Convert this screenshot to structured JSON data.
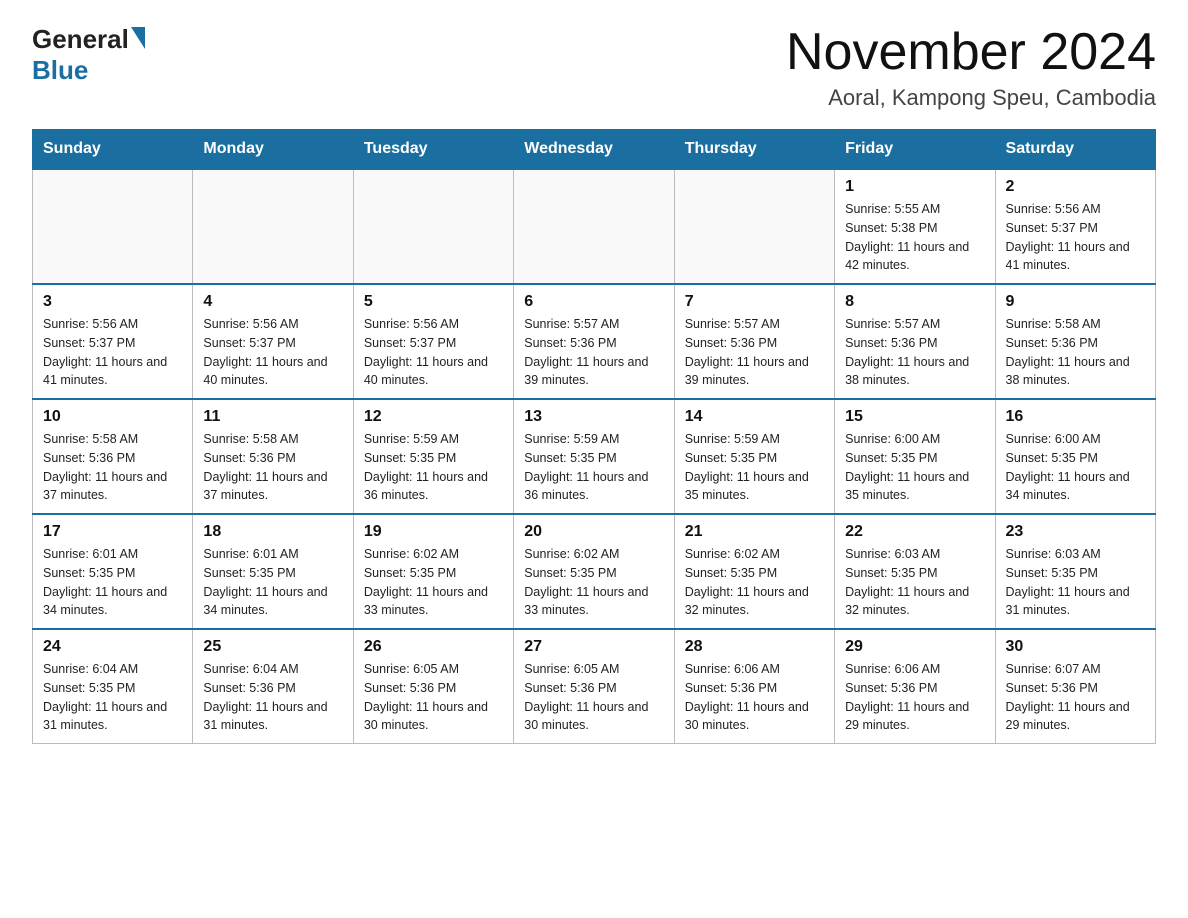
{
  "header": {
    "logo_general": "General",
    "logo_blue": "Blue",
    "month_year": "November 2024",
    "location": "Aoral, Kampong Speu, Cambodia"
  },
  "days_of_week": [
    "Sunday",
    "Monday",
    "Tuesday",
    "Wednesday",
    "Thursday",
    "Friday",
    "Saturday"
  ],
  "weeks": [
    [
      {
        "day": "",
        "sunrise": "",
        "sunset": "",
        "daylight": "",
        "empty": true
      },
      {
        "day": "",
        "sunrise": "",
        "sunset": "",
        "daylight": "",
        "empty": true
      },
      {
        "day": "",
        "sunrise": "",
        "sunset": "",
        "daylight": "",
        "empty": true
      },
      {
        "day": "",
        "sunrise": "",
        "sunset": "",
        "daylight": "",
        "empty": true
      },
      {
        "day": "",
        "sunrise": "",
        "sunset": "",
        "daylight": "",
        "empty": true
      },
      {
        "day": "1",
        "sunrise": "Sunrise: 5:55 AM",
        "sunset": "Sunset: 5:38 PM",
        "daylight": "Daylight: 11 hours and 42 minutes.",
        "empty": false
      },
      {
        "day": "2",
        "sunrise": "Sunrise: 5:56 AM",
        "sunset": "Sunset: 5:37 PM",
        "daylight": "Daylight: 11 hours and 41 minutes.",
        "empty": false
      }
    ],
    [
      {
        "day": "3",
        "sunrise": "Sunrise: 5:56 AM",
        "sunset": "Sunset: 5:37 PM",
        "daylight": "Daylight: 11 hours and 41 minutes.",
        "empty": false
      },
      {
        "day": "4",
        "sunrise": "Sunrise: 5:56 AM",
        "sunset": "Sunset: 5:37 PM",
        "daylight": "Daylight: 11 hours and 40 minutes.",
        "empty": false
      },
      {
        "day": "5",
        "sunrise": "Sunrise: 5:56 AM",
        "sunset": "Sunset: 5:37 PM",
        "daylight": "Daylight: 11 hours and 40 minutes.",
        "empty": false
      },
      {
        "day": "6",
        "sunrise": "Sunrise: 5:57 AM",
        "sunset": "Sunset: 5:36 PM",
        "daylight": "Daylight: 11 hours and 39 minutes.",
        "empty": false
      },
      {
        "day": "7",
        "sunrise": "Sunrise: 5:57 AM",
        "sunset": "Sunset: 5:36 PM",
        "daylight": "Daylight: 11 hours and 39 minutes.",
        "empty": false
      },
      {
        "day": "8",
        "sunrise": "Sunrise: 5:57 AM",
        "sunset": "Sunset: 5:36 PM",
        "daylight": "Daylight: 11 hours and 38 minutes.",
        "empty": false
      },
      {
        "day": "9",
        "sunrise": "Sunrise: 5:58 AM",
        "sunset": "Sunset: 5:36 PM",
        "daylight": "Daylight: 11 hours and 38 minutes.",
        "empty": false
      }
    ],
    [
      {
        "day": "10",
        "sunrise": "Sunrise: 5:58 AM",
        "sunset": "Sunset: 5:36 PM",
        "daylight": "Daylight: 11 hours and 37 minutes.",
        "empty": false
      },
      {
        "day": "11",
        "sunrise": "Sunrise: 5:58 AM",
        "sunset": "Sunset: 5:36 PM",
        "daylight": "Daylight: 11 hours and 37 minutes.",
        "empty": false
      },
      {
        "day": "12",
        "sunrise": "Sunrise: 5:59 AM",
        "sunset": "Sunset: 5:35 PM",
        "daylight": "Daylight: 11 hours and 36 minutes.",
        "empty": false
      },
      {
        "day": "13",
        "sunrise": "Sunrise: 5:59 AM",
        "sunset": "Sunset: 5:35 PM",
        "daylight": "Daylight: 11 hours and 36 minutes.",
        "empty": false
      },
      {
        "day": "14",
        "sunrise": "Sunrise: 5:59 AM",
        "sunset": "Sunset: 5:35 PM",
        "daylight": "Daylight: 11 hours and 35 minutes.",
        "empty": false
      },
      {
        "day": "15",
        "sunrise": "Sunrise: 6:00 AM",
        "sunset": "Sunset: 5:35 PM",
        "daylight": "Daylight: 11 hours and 35 minutes.",
        "empty": false
      },
      {
        "day": "16",
        "sunrise": "Sunrise: 6:00 AM",
        "sunset": "Sunset: 5:35 PM",
        "daylight": "Daylight: 11 hours and 34 minutes.",
        "empty": false
      }
    ],
    [
      {
        "day": "17",
        "sunrise": "Sunrise: 6:01 AM",
        "sunset": "Sunset: 5:35 PM",
        "daylight": "Daylight: 11 hours and 34 minutes.",
        "empty": false
      },
      {
        "day": "18",
        "sunrise": "Sunrise: 6:01 AM",
        "sunset": "Sunset: 5:35 PM",
        "daylight": "Daylight: 11 hours and 34 minutes.",
        "empty": false
      },
      {
        "day": "19",
        "sunrise": "Sunrise: 6:02 AM",
        "sunset": "Sunset: 5:35 PM",
        "daylight": "Daylight: 11 hours and 33 minutes.",
        "empty": false
      },
      {
        "day": "20",
        "sunrise": "Sunrise: 6:02 AM",
        "sunset": "Sunset: 5:35 PM",
        "daylight": "Daylight: 11 hours and 33 minutes.",
        "empty": false
      },
      {
        "day": "21",
        "sunrise": "Sunrise: 6:02 AM",
        "sunset": "Sunset: 5:35 PM",
        "daylight": "Daylight: 11 hours and 32 minutes.",
        "empty": false
      },
      {
        "day": "22",
        "sunrise": "Sunrise: 6:03 AM",
        "sunset": "Sunset: 5:35 PM",
        "daylight": "Daylight: 11 hours and 32 minutes.",
        "empty": false
      },
      {
        "day": "23",
        "sunrise": "Sunrise: 6:03 AM",
        "sunset": "Sunset: 5:35 PM",
        "daylight": "Daylight: 11 hours and 31 minutes.",
        "empty": false
      }
    ],
    [
      {
        "day": "24",
        "sunrise": "Sunrise: 6:04 AM",
        "sunset": "Sunset: 5:35 PM",
        "daylight": "Daylight: 11 hours and 31 minutes.",
        "empty": false
      },
      {
        "day": "25",
        "sunrise": "Sunrise: 6:04 AM",
        "sunset": "Sunset: 5:36 PM",
        "daylight": "Daylight: 11 hours and 31 minutes.",
        "empty": false
      },
      {
        "day": "26",
        "sunrise": "Sunrise: 6:05 AM",
        "sunset": "Sunset: 5:36 PM",
        "daylight": "Daylight: 11 hours and 30 minutes.",
        "empty": false
      },
      {
        "day": "27",
        "sunrise": "Sunrise: 6:05 AM",
        "sunset": "Sunset: 5:36 PM",
        "daylight": "Daylight: 11 hours and 30 minutes.",
        "empty": false
      },
      {
        "day": "28",
        "sunrise": "Sunrise: 6:06 AM",
        "sunset": "Sunset: 5:36 PM",
        "daylight": "Daylight: 11 hours and 30 minutes.",
        "empty": false
      },
      {
        "day": "29",
        "sunrise": "Sunrise: 6:06 AM",
        "sunset": "Sunset: 5:36 PM",
        "daylight": "Daylight: 11 hours and 29 minutes.",
        "empty": false
      },
      {
        "day": "30",
        "sunrise": "Sunrise: 6:07 AM",
        "sunset": "Sunset: 5:36 PM",
        "daylight": "Daylight: 11 hours and 29 minutes.",
        "empty": false
      }
    ]
  ]
}
